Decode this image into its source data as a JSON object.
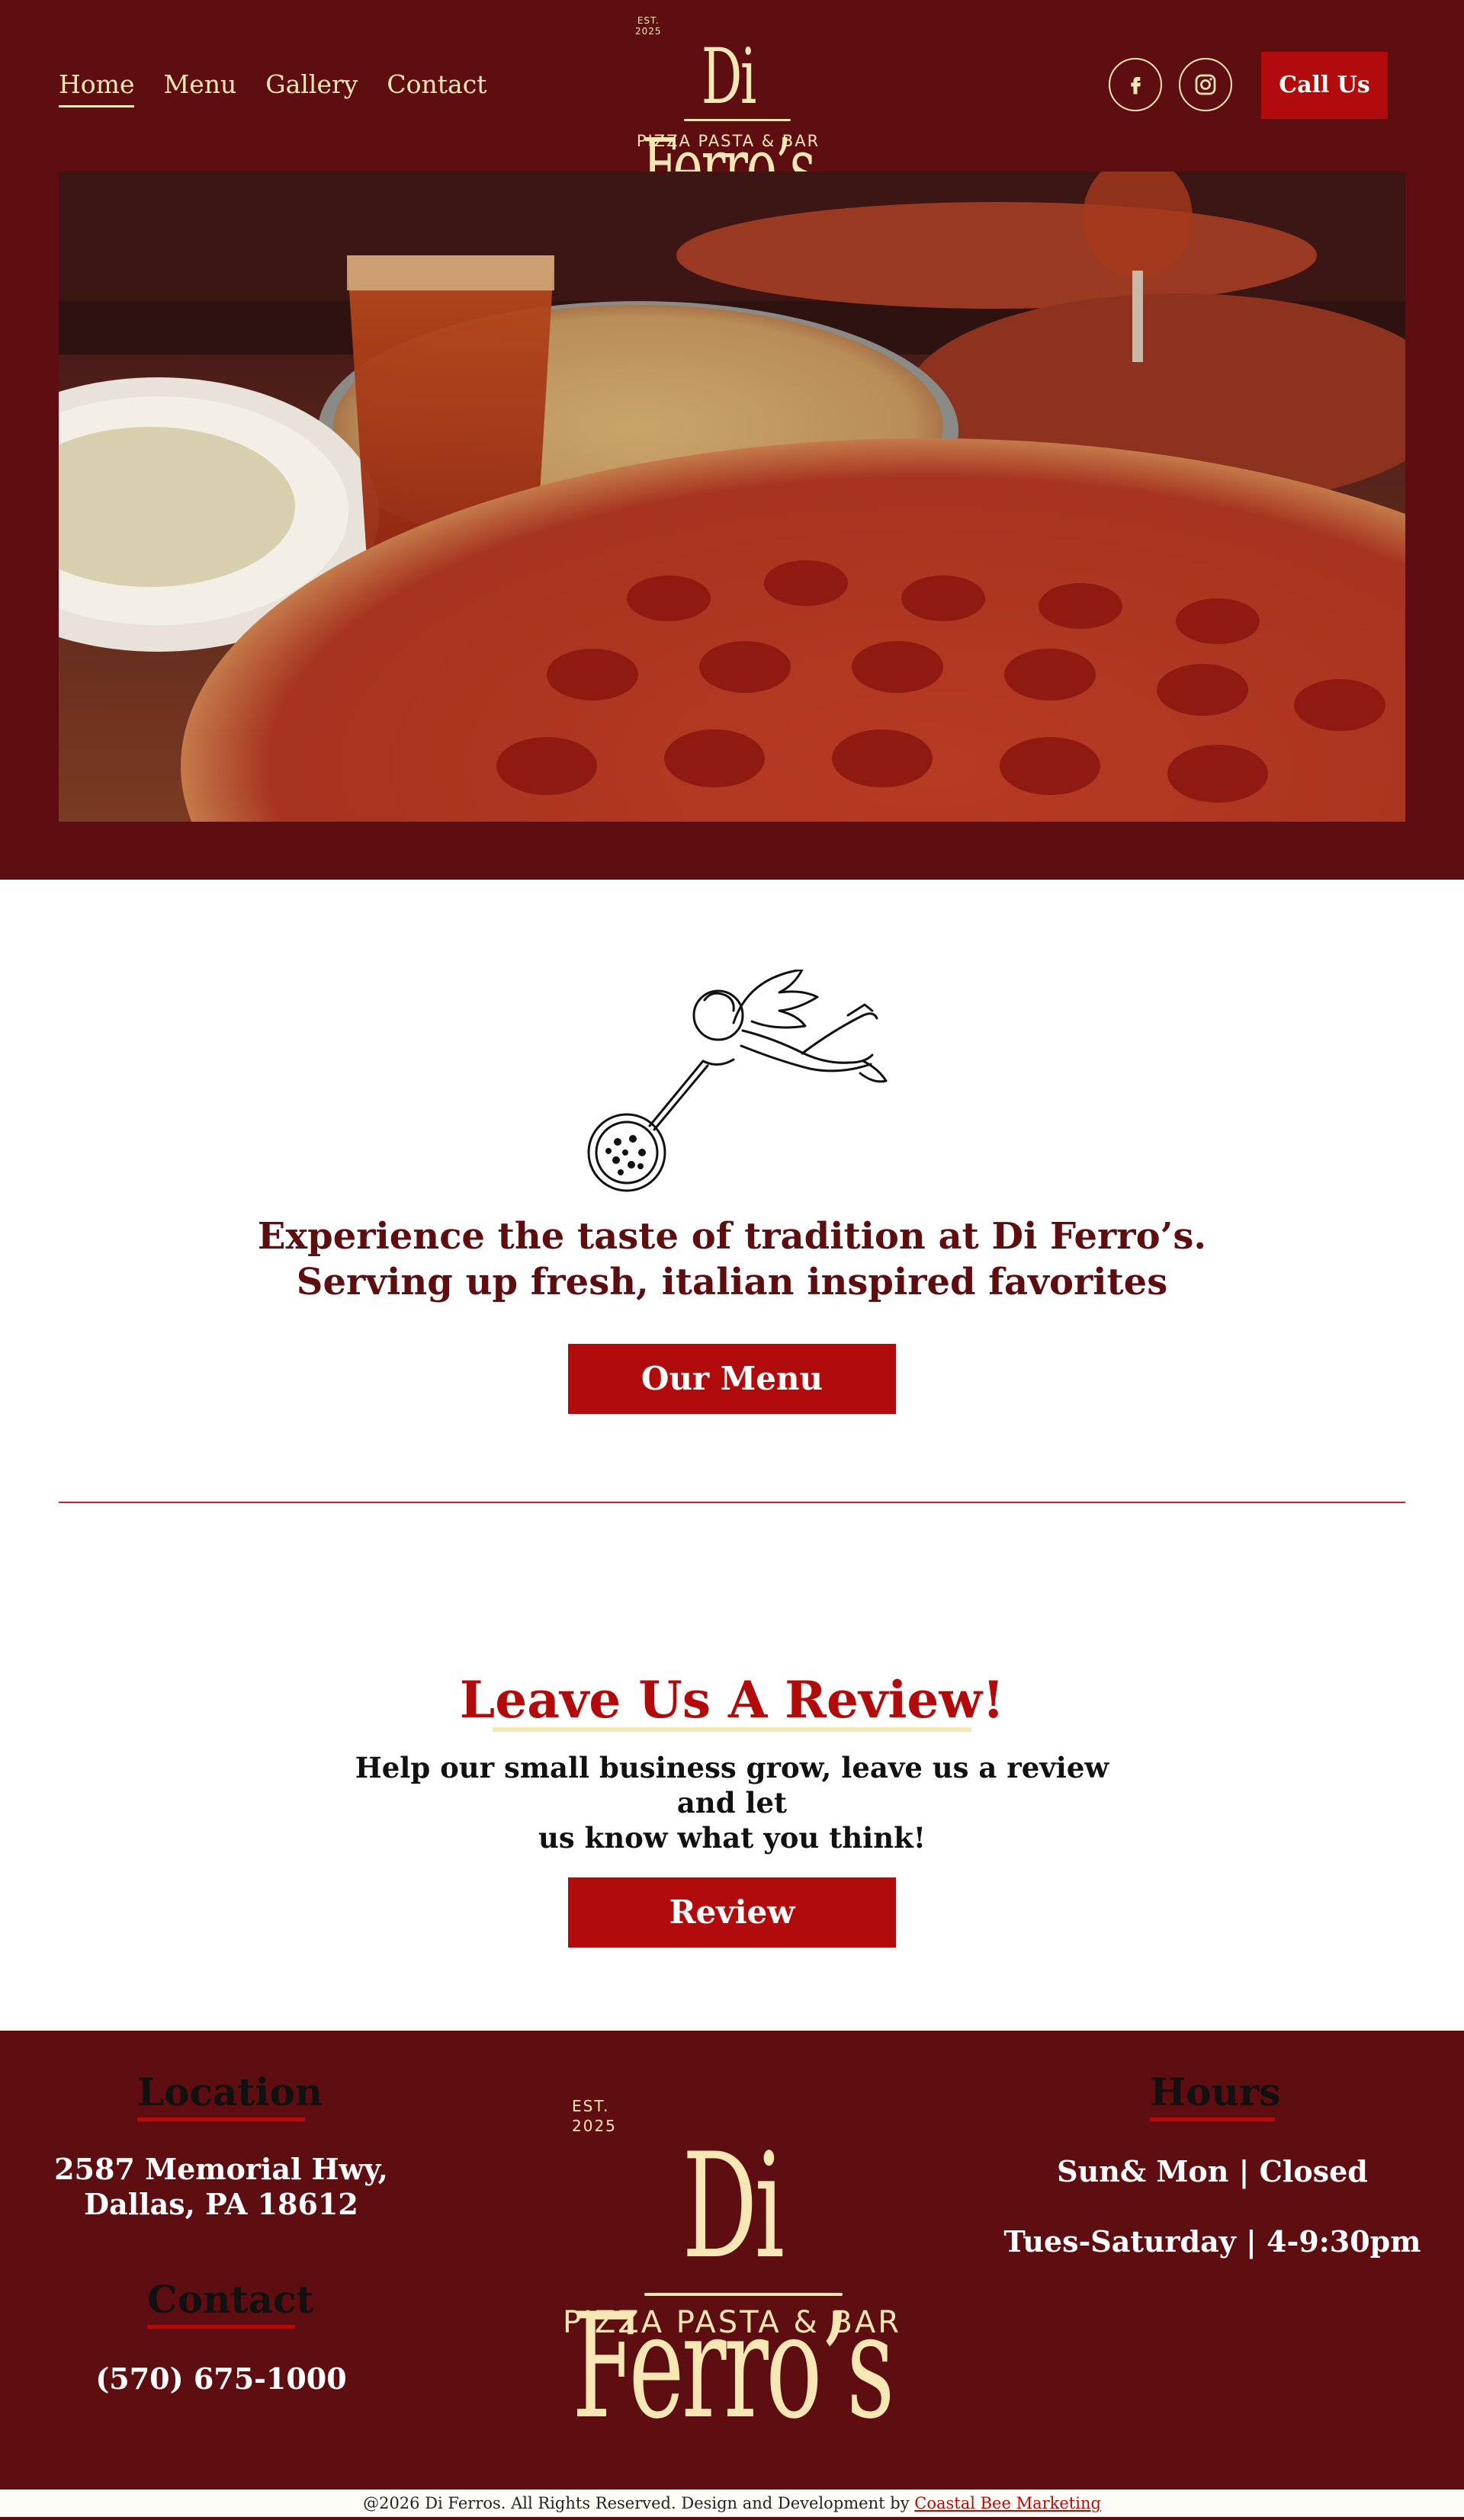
{
  "nav": {
    "items": [
      {
        "label": "Home",
        "active": true
      },
      {
        "label": "Menu",
        "active": false
      },
      {
        "label": "Gallery",
        "active": false
      },
      {
        "label": "Contact",
        "active": false
      }
    ]
  },
  "logo": {
    "est_line1": "EST.",
    "est_line2": "2025",
    "name": "Di Ferro’s",
    "subtitle": "PIZZA PASTA & BAR"
  },
  "header": {
    "social": [
      {
        "icon": "facebook-icon"
      },
      {
        "icon": "instagram-icon"
      }
    ],
    "call_label": "Call Us"
  },
  "hero": {
    "image_subject": "photo-pizza-table"
  },
  "intro": {
    "line1": "Experience the taste of tradition at Di Ferro’s.",
    "line2": "Serving up fresh, italian inspired favorites",
    "button_label": "Our Menu"
  },
  "review": {
    "title": "Leave Us A Review!",
    "text_line1": "Help our small business grow, leave us a review and let",
    "text_line2": "us know what you think!",
    "button_label": "Review"
  },
  "footer": {
    "location_heading": "Location",
    "address_line1": "2587 Memorial Hwy,",
    "address_line2": "Dallas, PA 18612",
    "contact_heading": "Contact",
    "phone": "(570) 675-1000",
    "hours_heading": "Hours",
    "hours_line1": "Sun& Mon | Closed",
    "hours_line2": "Tues-Saturday | 4-9:30pm"
  },
  "bottom_bar": {
    "text": "@2026 Di Ferros. All Rights Reserved. Design and Development by ",
    "link_label": "Coastal Bee Marketing"
  },
  "colors": {
    "maroon": "#5e0e10",
    "red": "#b10b0c",
    "cream": "#f6e7b4"
  }
}
